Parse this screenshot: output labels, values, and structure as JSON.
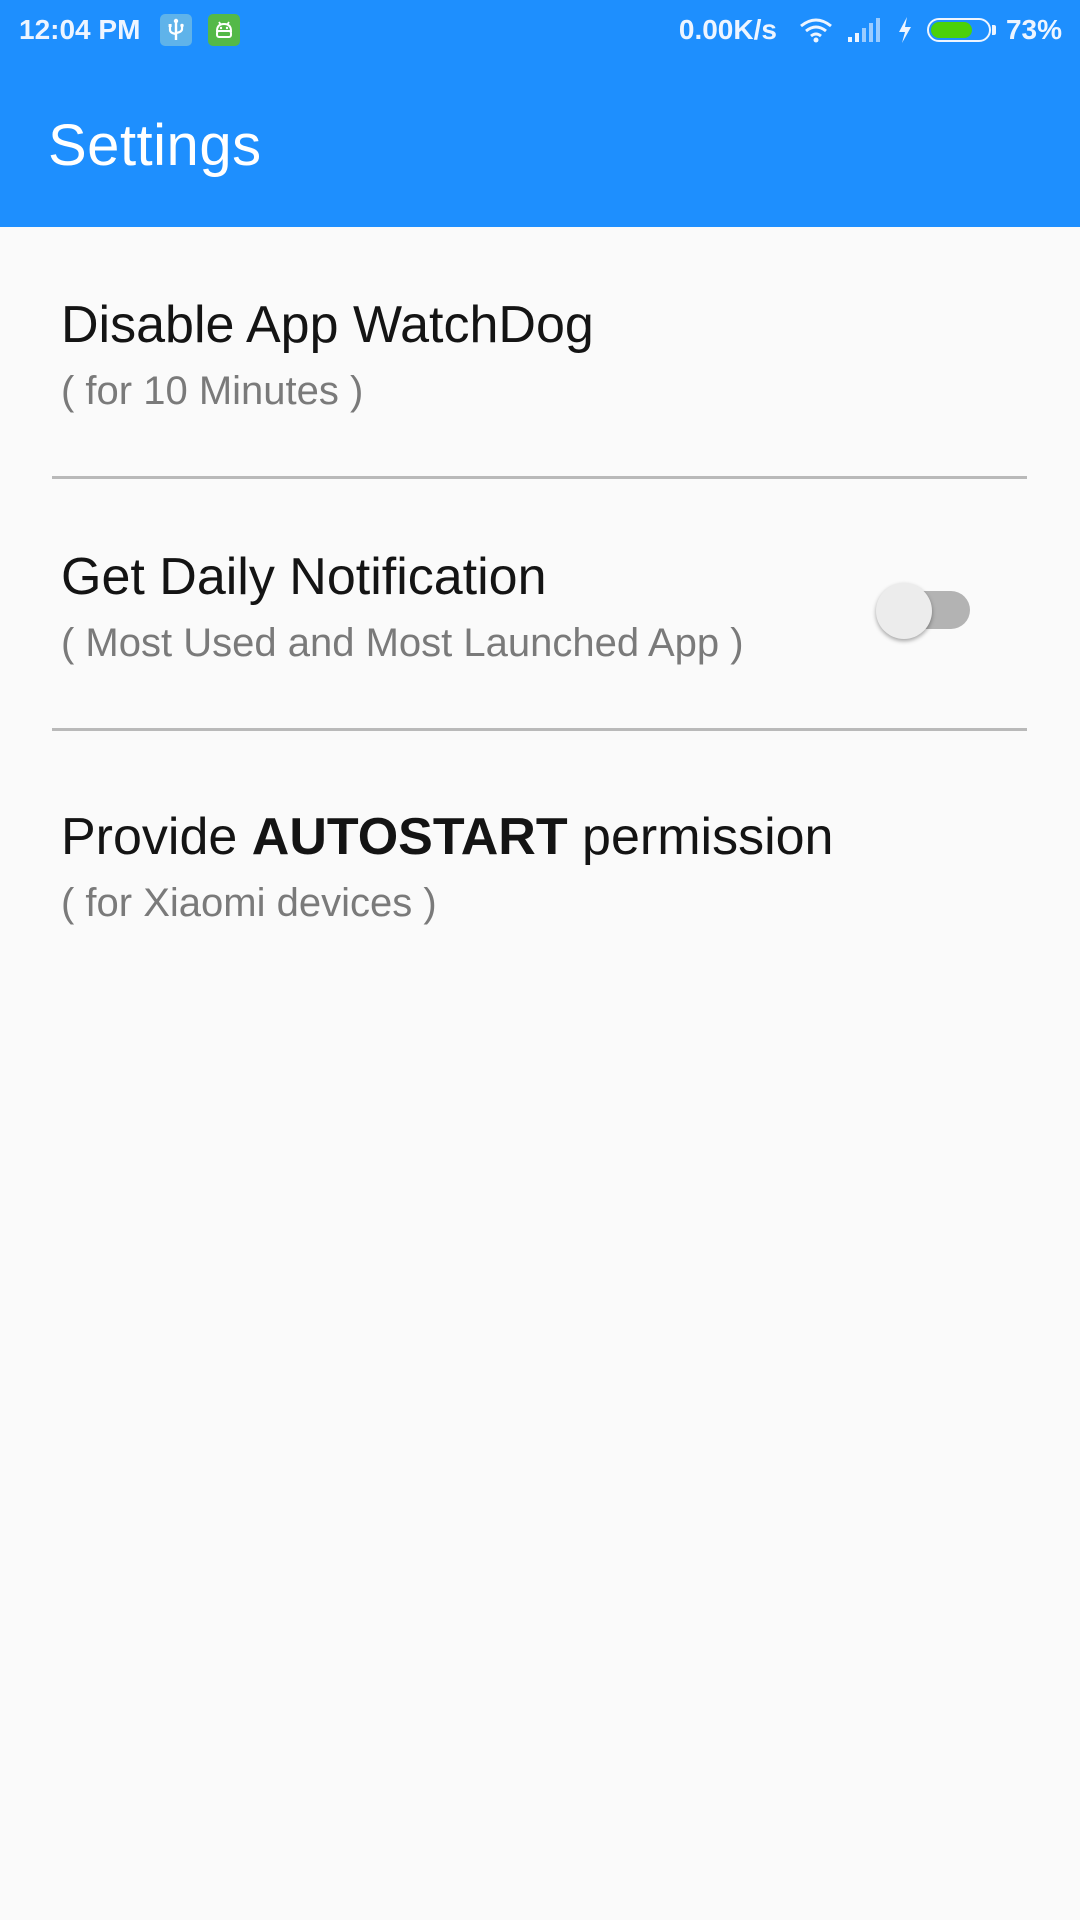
{
  "status_bar": {
    "time": "12:04 PM",
    "net_speed": "0.00K/s",
    "battery_percent": "73%",
    "battery_level": 0.73,
    "icons": [
      "usb-icon",
      "android-icon",
      "wifi-icon",
      "signal-icon",
      "charging-icon",
      "battery-icon"
    ]
  },
  "app_bar": {
    "title": "Settings"
  },
  "settings": {
    "watchdog": {
      "title": "Disable App WatchDog",
      "subtitle": "( for 10 Minutes )"
    },
    "notification": {
      "title": "Get Daily Notification",
      "subtitle": "( Most Used and Most Launched App )",
      "toggle_on": false
    },
    "autostart": {
      "title_prefix": "Provide ",
      "title_bold": "AUTOSTART",
      "title_suffix": " permission",
      "subtitle": "( for Xiaomi devices )"
    }
  },
  "colors": {
    "app_bar": "#1e8ffe",
    "background": "#fafafa",
    "battery_fill": "#4bd10a",
    "divider": "#b9b9b9",
    "subtitle_text": "#7a7a7a"
  }
}
